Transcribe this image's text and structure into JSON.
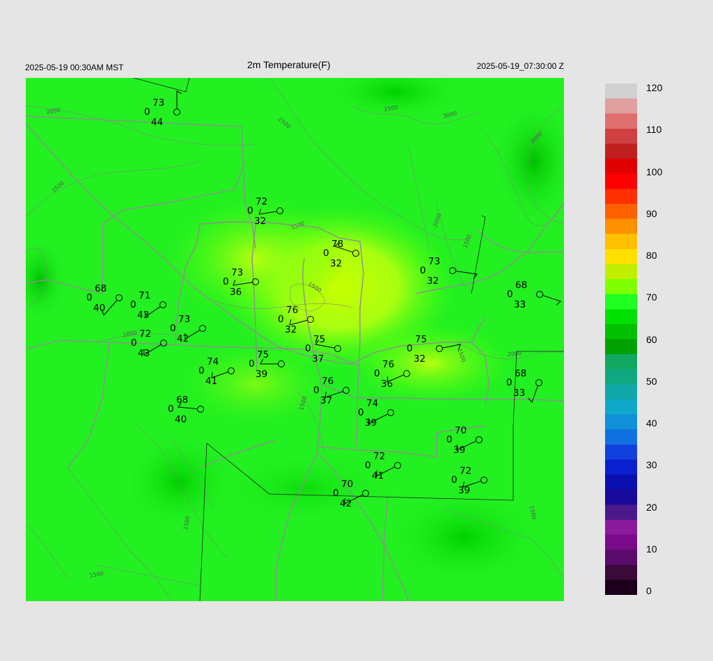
{
  "header": {
    "local_time": "2025-05-19 00:30AM MST",
    "title": "2m Temperature(F)",
    "utc_time": "2025-05-19_07:30:00 Z"
  },
  "colorbar": {
    "labels": [
      "120",
      "110",
      "100",
      "90",
      "80",
      "70",
      "60",
      "50",
      "40",
      "30",
      "20",
      "10",
      "0"
    ],
    "min": 0,
    "max": 120,
    "colors": [
      "#1a001a",
      "#3a0a3a",
      "#5a0a6a",
      "#7a0a8a",
      "#8a1a9a",
      "#4a1a8a",
      "#1a0a9a",
      "#0a10b0",
      "#0a20d0",
      "#1040e0",
      "#1070e0",
      "#1090d8",
      "#10a8c8",
      "#10a8a8",
      "#10a880",
      "#10a860",
      "#00a000",
      "#00c000",
      "#00e000",
      "#20ff20",
      "#80ff00",
      "#c0f000",
      "#ffe000",
      "#ffc000",
      "#ff9000",
      "#ff6000",
      "#ff3000",
      "#ff0000",
      "#e00000",
      "#c02020",
      "#d04040",
      "#e07070",
      "#e0a0a0",
      "#d0d0d0"
    ]
  },
  "contours": [
    "2000",
    "2500",
    "3000",
    "2500",
    "2000",
    "1500",
    "2000",
    "1500",
    "1500",
    "1000",
    "1500",
    "1500",
    "2000",
    "1500",
    "1500",
    "1500",
    "1500"
  ],
  "stations": [
    {
      "temp": "73",
      "dew": "44",
      "wind": "0"
    },
    {
      "temp": "72",
      "dew": "32",
      "wind": "0"
    },
    {
      "temp": "78",
      "dew": "32",
      "wind": "0"
    },
    {
      "temp": "73",
      "dew": "32",
      "wind": "0"
    },
    {
      "temp": "68",
      "dew": "40",
      "wind": "0"
    },
    {
      "temp": "71",
      "dew": "43",
      "wind": "0"
    },
    {
      "temp": "73",
      "dew": "36",
      "wind": "0"
    },
    {
      "temp": "68",
      "dew": "33",
      "wind": "0"
    },
    {
      "temp": "76",
      "dew": "32",
      "wind": "0"
    },
    {
      "temp": "73",
      "dew": "42",
      "wind": "0"
    },
    {
      "temp": "72",
      "dew": "43",
      "wind": "0"
    },
    {
      "temp": "75",
      "dew": "37",
      "wind": "0"
    },
    {
      "temp": "75",
      "dew": "32",
      "wind": "0"
    },
    {
      "temp": "75",
      "dew": "39",
      "wind": "0"
    },
    {
      "temp": "74",
      "dew": "41",
      "wind": "0"
    },
    {
      "temp": "76",
      "dew": "36",
      "wind": "0"
    },
    {
      "temp": "68",
      "dew": "33",
      "wind": "0"
    },
    {
      "temp": "76",
      "dew": "37",
      "wind": "0"
    },
    {
      "temp": "68",
      "dew": "40",
      "wind": "0"
    },
    {
      "temp": "74",
      "dew": "39",
      "wind": "0"
    },
    {
      "temp": "70",
      "dew": "39",
      "wind": "0"
    },
    {
      "temp": "72",
      "dew": "41",
      "wind": "0"
    },
    {
      "temp": "72",
      "dew": "39",
      "wind": "0"
    },
    {
      "temp": "70",
      "dew": "42",
      "wind": "0"
    }
  ]
}
